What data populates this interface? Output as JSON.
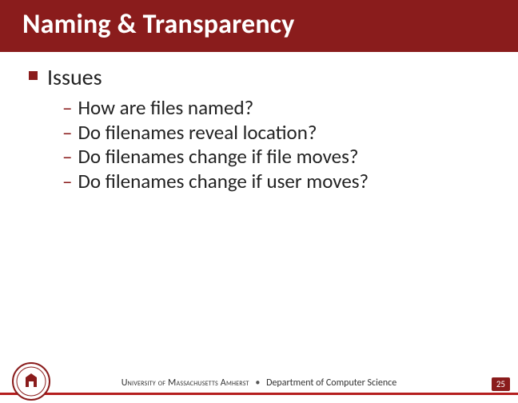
{
  "title": "Naming & Transparency",
  "section": {
    "heading": "Issues",
    "items": [
      "How are files named?",
      "Do filenames reveal location?",
      "Do filenames change if file moves?",
      "Do filenames change if user moves?"
    ]
  },
  "footer": {
    "university": "University of Massachusetts Amherst",
    "separator": "•",
    "department": "Department of Computer Science",
    "page_number": "25"
  }
}
